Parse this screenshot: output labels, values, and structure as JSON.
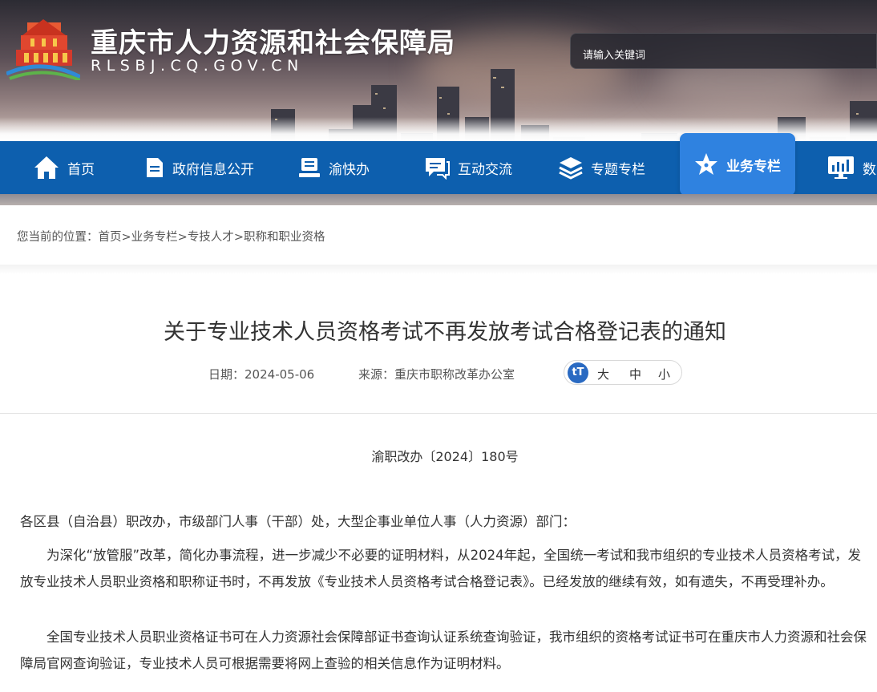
{
  "header": {
    "site_title": "重庆市人力资源和社会保障局",
    "site_domain": "RLSBJ.CQ.GOV.CN",
    "search_placeholder": "请输入关键词"
  },
  "nav": {
    "items": [
      {
        "label": "首页",
        "icon": "home-icon"
      },
      {
        "label": "政府信息公开",
        "icon": "document-icon"
      },
      {
        "label": "渝快办",
        "icon": "service-desk-icon"
      },
      {
        "label": "互动交流",
        "icon": "chat-icon"
      },
      {
        "label": "专题专栏",
        "icon": "layers-icon"
      },
      {
        "label": "业务专栏",
        "icon": "star-icon",
        "active": true
      },
      {
        "label": "数",
        "icon": "data-screen-icon"
      }
    ]
  },
  "breadcrumb": {
    "prefix": "您当前的位置：",
    "items": [
      "首页",
      "业务专栏",
      "专技人才",
      "职称和职业资格"
    ],
    "sep": ">"
  },
  "article": {
    "title": "关于专业技术人员资格考试不再发放考试合格登记表的通知",
    "date_label": "日期：",
    "date": "2024-05-06",
    "source_label": "来源：",
    "source": "重庆市职称改革办公室",
    "font_switch": {
      "icon_text": "tT",
      "large": "大",
      "medium": "中",
      "small": "小"
    },
    "doc_number": "渝职改办〔2024〕180号",
    "salutation": "各区县（自治县）职改办，市级部门人事（干部）处，大型企事业单位人事（人力资源）部门：",
    "paragraph1": "为深化“放管服”改革，简化办事流程，进一步减少不必要的证明材料，从2024年起，全国统一考试和我市组织的专业技术人员资格考试，发放专业技术人员职业资格和职称证书时，不再发放《专业技术人员资格考试合格登记表》。已经发放的继续有效，如有遗失，不再受理补办。",
    "paragraph2": "全国专业技术人员职业资格证书可在人力资源社会保障部证书查询认证系统查询验证，我市组织的资格考试证书可在重庆市人力资源和社会保障局官网查询验证，专业技术人员可根据需要将网上查验的相关信息作为证明材料。"
  },
  "colors": {
    "nav_bg": "#0d5fae",
    "nav_active": "#2f82e0",
    "font_icon": "#2a6ac2"
  }
}
